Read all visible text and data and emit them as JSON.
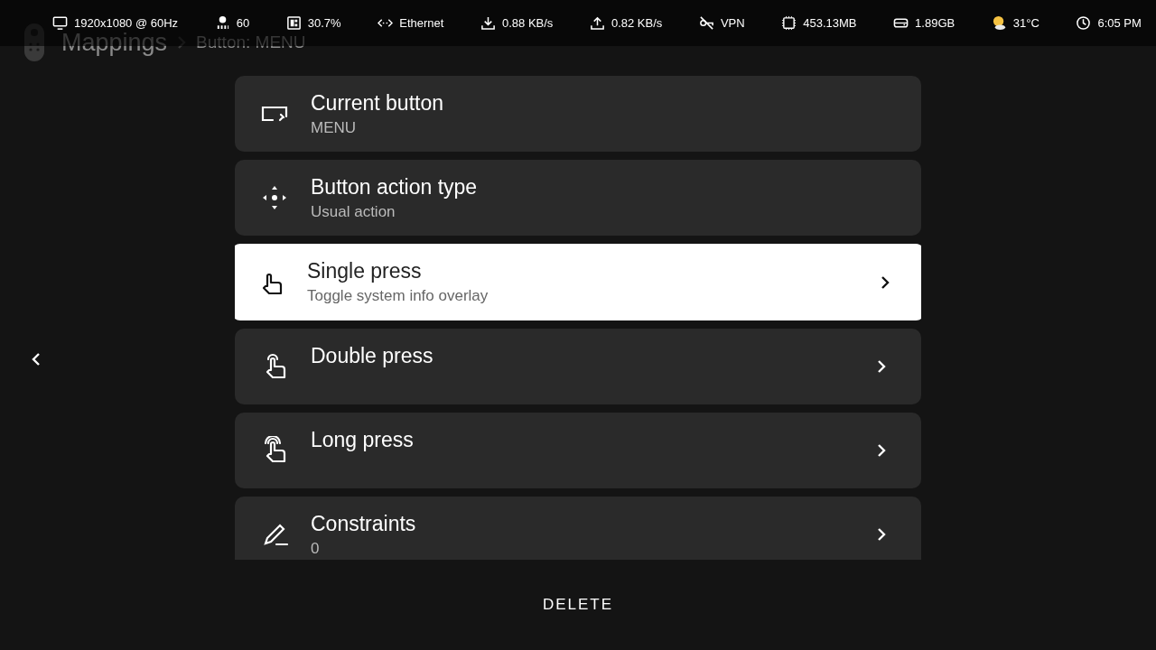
{
  "header": {
    "title": "Mappings",
    "subtitle": "Button: MENU"
  },
  "status_bar": [
    {
      "text": "1920x1080 @ 60Hz"
    },
    {
      "text": "60"
    },
    {
      "text": "30.7%"
    },
    {
      "text": "Ethernet"
    },
    {
      "text": "0.88 KB/s"
    },
    {
      "text": "0.82 KB/s"
    },
    {
      "text": "VPN"
    },
    {
      "text": "453.13MB"
    },
    {
      "text": "1.89GB"
    },
    {
      "text": "31°C"
    },
    {
      "text": "6:05 PM"
    }
  ],
  "items": [
    {
      "kind": "info",
      "title": "Current button",
      "subtitle": "MENU",
      "selected": false
    },
    {
      "kind": "info",
      "title": "Button action type",
      "subtitle": "Usual action",
      "selected": false
    },
    {
      "kind": "link",
      "title": "Single press",
      "subtitle": "Toggle system info overlay",
      "selected": true
    },
    {
      "kind": "link",
      "title": "Double press",
      "selected": false
    },
    {
      "kind": "link",
      "title": "Long press",
      "selected": false
    },
    {
      "kind": "link",
      "title": "Constraints",
      "subtitle": "0",
      "selected": false
    }
  ],
  "delete_button": "DELETE"
}
